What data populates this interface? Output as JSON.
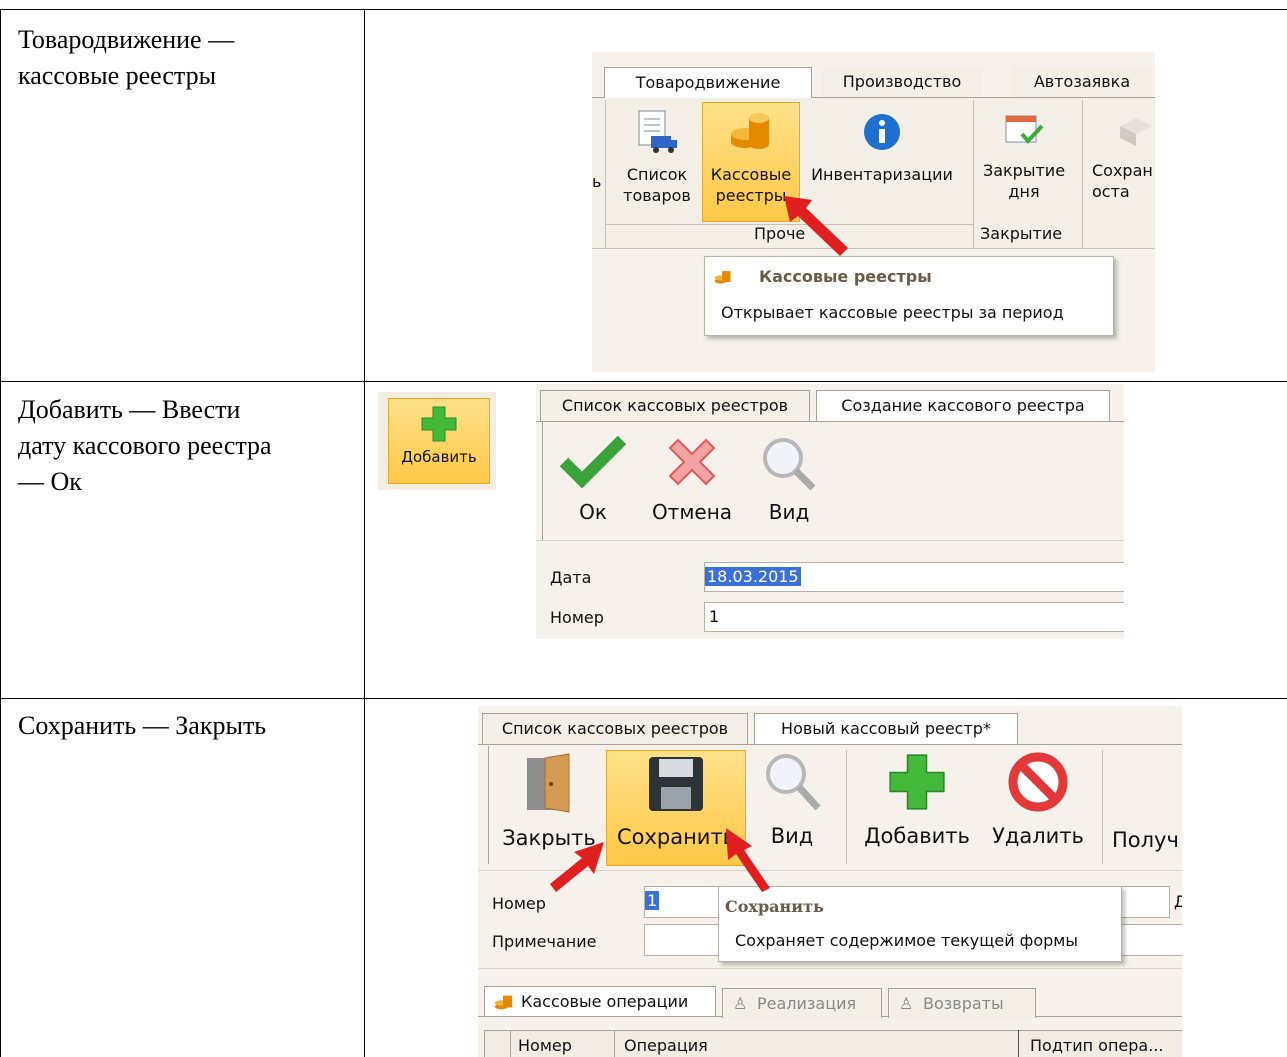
{
  "rows": [
    {
      "instruction": "Товародвижение —\nкассовые реестры",
      "screenshot": {
        "tabs": [
          "Товародвижение",
          "Производство",
          "Автозаявка"
        ],
        "buttons": [
          {
            "label": "Список\nтоваров",
            "icon": "document-truck-icon"
          },
          {
            "label": "Кассовые\nреестры",
            "icon": "coins-icon"
          },
          {
            "label": "Инвентаризации",
            "icon": "info-icon"
          },
          {
            "label": "Закрытие\nдня",
            "icon": "calendar-check-icon"
          },
          {
            "label": "Сохран\nоста",
            "icon": "box-icon"
          }
        ],
        "groups": [
          "Проче",
          "Закрытие"
        ],
        "left_fragment": "ь",
        "tooltip": {
          "title": "Кассовые реестры",
          "text": "Открывает кассовые реестры за период"
        }
      }
    },
    {
      "instruction": "Добавить — Ввести\nдату кассового реестра\n— Ок",
      "add_button": {
        "label": "Добавить",
        "icon": "plus-icon"
      },
      "screenshot": {
        "tabs": [
          "Список кассовых реестров",
          "Создание кассового реестра"
        ],
        "buttons": [
          {
            "label": "Ок",
            "icon": "checkmark-icon"
          },
          {
            "label": "Отмена",
            "icon": "cross-icon"
          },
          {
            "label": "Вид",
            "icon": "magnifier-icon"
          }
        ],
        "fields": [
          {
            "label": "Дата",
            "value": "18.03.2015"
          },
          {
            "label": "Номер",
            "value": "1"
          }
        ]
      }
    },
    {
      "instruction": "Сохранить — Закрыть",
      "screenshot": {
        "tabs": [
          "Список кассовых реестров",
          "Новый кассовый реестр*"
        ],
        "buttons": [
          {
            "label": "Закрыть",
            "icon": "door-icon"
          },
          {
            "label": "Сохранить",
            "icon": "floppy-disk-icon"
          },
          {
            "label": "Вид",
            "icon": "magnifier-icon"
          },
          {
            "label": "Добавить",
            "icon": "plus-icon"
          },
          {
            "label": "Удалить",
            "icon": "prohibit-icon"
          },
          {
            "label": "Получ",
            "icon": ""
          }
        ],
        "fields": [
          {
            "label": "Номер",
            "value": "1"
          },
          {
            "label": "Примечание",
            "value": ""
          }
        ],
        "cut_char": "Д",
        "tooltip": {
          "title": "Сохранить",
          "text": "Сохраняет содержимое текущей формы"
        },
        "subtabs": [
          "Кассовые операции",
          "Реализация",
          "Возвраты"
        ],
        "columns": [
          "Номер",
          "Операция",
          "Подтип опера..."
        ]
      }
    }
  ],
  "colors": {
    "highlight": "#ffc846",
    "arrow": "#e02020",
    "panel_bg": "#f6f1ea",
    "selection": "#3b6fd9"
  }
}
